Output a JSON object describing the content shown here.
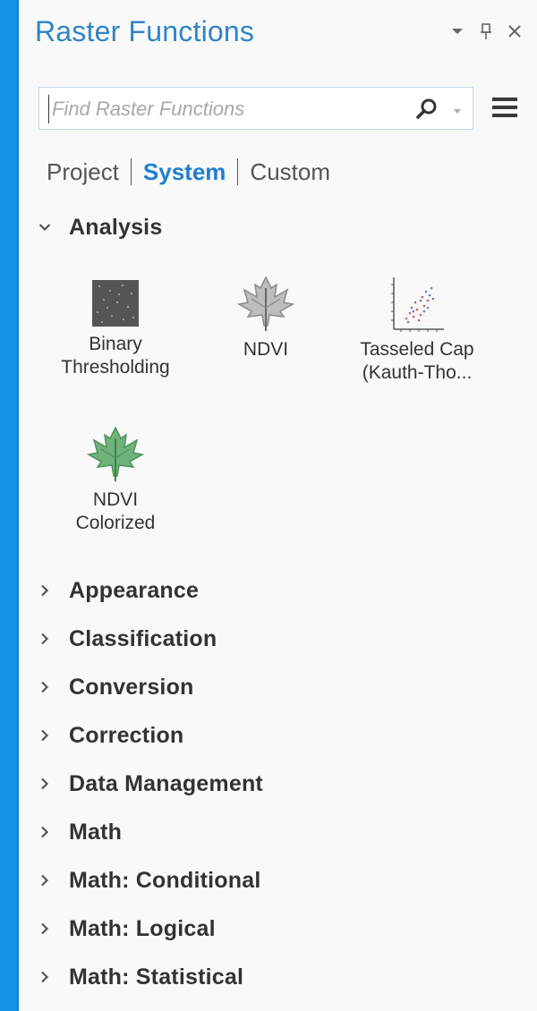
{
  "panel": {
    "title": "Raster Functions"
  },
  "search": {
    "placeholder": "Find Raster Functions",
    "value": ""
  },
  "tabs": [
    {
      "label": "Project",
      "active": false
    },
    {
      "label": "System",
      "active": true
    },
    {
      "label": "Custom",
      "active": false
    }
  ],
  "analysis": {
    "label": "Analysis",
    "expanded": true,
    "items": [
      {
        "label_line1": "Binary",
        "label_line2": "Thresholding",
        "icon": "binary-thresholding-icon"
      },
      {
        "label_line1": "NDVI",
        "label_line2": "",
        "icon": "ndvi-leaf-icon"
      },
      {
        "label_line1": "Tasseled Cap",
        "label_line2": "(Kauth-Tho...",
        "icon": "tasseled-cap-icon"
      },
      {
        "label_line1": "NDVI",
        "label_line2": "Colorized",
        "icon": "ndvi-colorized-leaf-icon"
      }
    ]
  },
  "groups": [
    {
      "label": "Appearance"
    },
    {
      "label": "Classification"
    },
    {
      "label": "Conversion"
    },
    {
      "label": "Correction"
    },
    {
      "label": "Data Management"
    },
    {
      "label": "Math"
    },
    {
      "label": "Math: Conditional"
    },
    {
      "label": "Math: Logical"
    },
    {
      "label": "Math: Statistical"
    }
  ],
  "colors": {
    "accent": "#1f7fce",
    "title": "#2f84c8",
    "frame": "#0a8ce0",
    "leaf_gray": "#9a9a9a",
    "leaf_green": "#5fa46a"
  }
}
